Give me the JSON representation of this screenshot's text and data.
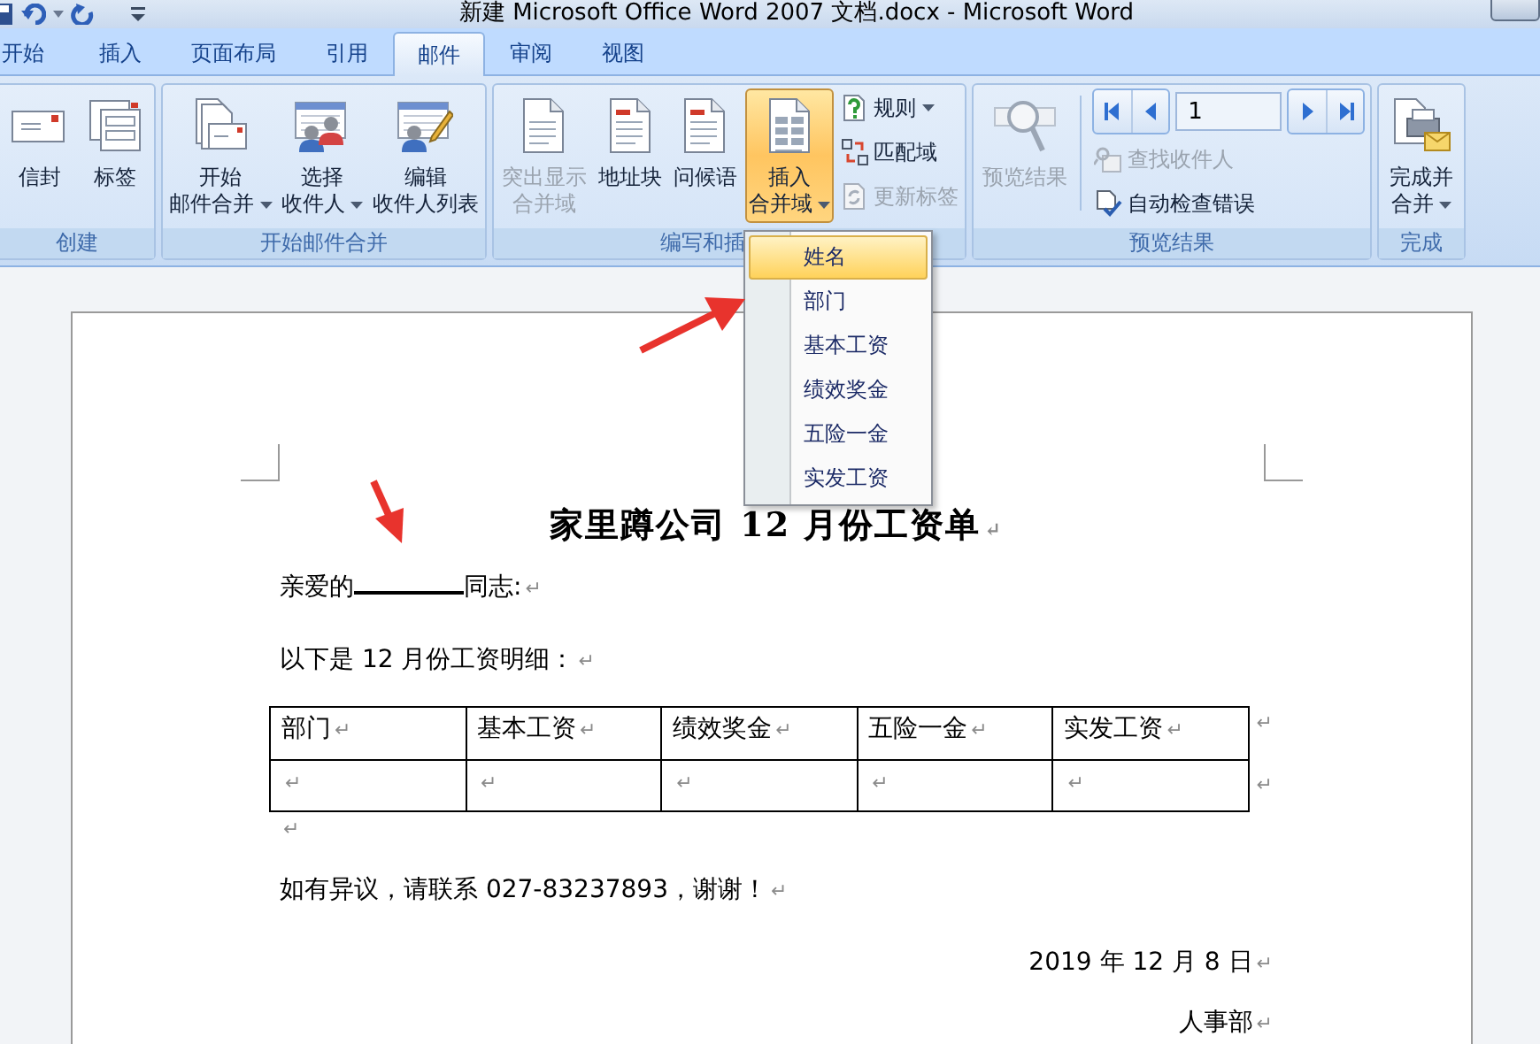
{
  "title_bar": {
    "title": "新建 Microsoft Office Word 2007 文档.docx - Microsoft Word"
  },
  "tabs": [
    {
      "label": "开始",
      "selected": false
    },
    {
      "label": "插入",
      "selected": false
    },
    {
      "label": "页面布局",
      "selected": false
    },
    {
      "label": "引用",
      "selected": false
    },
    {
      "label": "邮件",
      "selected": true
    },
    {
      "label": "审阅",
      "selected": false
    },
    {
      "label": "视图",
      "selected": false
    }
  ],
  "ribbon": {
    "groups": [
      {
        "label": "创建",
        "items": [
          {
            "kind": "large",
            "lines": [
              "信封"
            ],
            "dropdown": false,
            "disabled": false,
            "pressed": false
          },
          {
            "kind": "large",
            "lines": [
              "标签"
            ],
            "dropdown": false,
            "disabled": false,
            "pressed": false
          }
        ]
      },
      {
        "label": "开始邮件合并",
        "items": [
          {
            "kind": "large",
            "lines": [
              "开始",
              "邮件合并"
            ],
            "dropdown": true,
            "disabled": false,
            "pressed": false
          },
          {
            "kind": "large",
            "lines": [
              "选择",
              "收件人"
            ],
            "dropdown": true,
            "disabled": false,
            "pressed": false
          },
          {
            "kind": "large",
            "lines": [
              "编辑",
              "收件人列表"
            ],
            "dropdown": false,
            "disabled": false,
            "pressed": false
          }
        ]
      },
      {
        "label": "编写和插",
        "items": [
          {
            "kind": "large",
            "lines": [
              "突出显示",
              "合并域"
            ],
            "dropdown": false,
            "disabled": true,
            "pressed": false
          },
          {
            "kind": "large",
            "lines": [
              "地址块"
            ],
            "dropdown": false,
            "disabled": false,
            "pressed": false
          },
          {
            "kind": "large",
            "lines": [
              "问候语"
            ],
            "dropdown": false,
            "disabled": false,
            "pressed": false
          },
          {
            "kind": "large",
            "lines": [
              "插入",
              "合并域"
            ],
            "dropdown": true,
            "disabled": false,
            "pressed": true
          },
          {
            "kind": "column",
            "rows": [
              {
                "kind": "small",
                "label": "规则",
                "dropdown": true,
                "disabled": false
              },
              {
                "kind": "small",
                "label": "匹配域",
                "dropdown": false,
                "disabled": false
              },
              {
                "kind": "small",
                "label": "更新标签",
                "dropdown": false,
                "disabled": true
              }
            ]
          }
        ]
      },
      {
        "label": "预览结果",
        "items": [
          {
            "kind": "large",
            "lines": [
              "预览结果"
            ],
            "dropdown": false,
            "disabled": true,
            "pressed": false
          },
          {
            "kind": "column",
            "rows": [
              {
                "kind": "nav",
                "record": "1"
              },
              {
                "kind": "small",
                "label": "查找收件人",
                "dropdown": false,
                "disabled": true
              },
              {
                "kind": "small",
                "label": "自动检查错误",
                "dropdown": false,
                "disabled": false
              }
            ]
          }
        ]
      },
      {
        "label": "完成",
        "items": [
          {
            "kind": "large",
            "lines": [
              "完成并",
              "合并"
            ],
            "dropdown": true,
            "disabled": false,
            "pressed": false
          }
        ]
      }
    ]
  },
  "merge_field_menu": {
    "items": [
      {
        "label": "姓名",
        "selected": true
      },
      {
        "label": "部门",
        "selected": false
      },
      {
        "label": "基本工资",
        "selected": false
      },
      {
        "label": "绩效奖金",
        "selected": false
      },
      {
        "label": "五险一金",
        "selected": false
      },
      {
        "label": "实发工资",
        "selected": false
      }
    ]
  },
  "document": {
    "blocks": [
      {
        "kind": "heading",
        "text": "家里蹲公司 12 月份工资单",
        "mark": "↵"
      },
      {
        "kind": "greeting",
        "before": "亲爱的",
        "after": "同志:",
        "mark": "↵"
      },
      {
        "kind": "text",
        "text": "以下是 12 月份工资明细：",
        "mark": "↵"
      },
      {
        "kind": "table",
        "rows": [
          {
            "cells": [
              {
                "text": "部门",
                "mark": "↵"
              },
              {
                "text": "基本工资",
                "mark": "↵"
              },
              {
                "text": "绩效奖金",
                "mark": "↵"
              },
              {
                "text": "五险一金",
                "mark": "↵"
              },
              {
                "text": "实发工资",
                "mark": "↵"
              }
            ],
            "end_mark": "↵"
          },
          {
            "cells": [
              {
                "mark": "↵"
              },
              {
                "mark": "↵"
              },
              {
                "mark": "↵"
              },
              {
                "mark": "↵"
              },
              {
                "mark": "↵"
              }
            ],
            "end_mark": "↵"
          }
        ]
      },
      {
        "kind": "empty",
        "mark": "↵"
      },
      {
        "kind": "text",
        "text": "如有异议，请联系 027-83237893，谢谢！",
        "mark": "↵"
      },
      {
        "kind": "right",
        "text": "2019 年 12 月 8 日",
        "mark": "↵"
      },
      {
        "kind": "right",
        "text": "人事部",
        "mark": "↵"
      }
    ]
  }
}
